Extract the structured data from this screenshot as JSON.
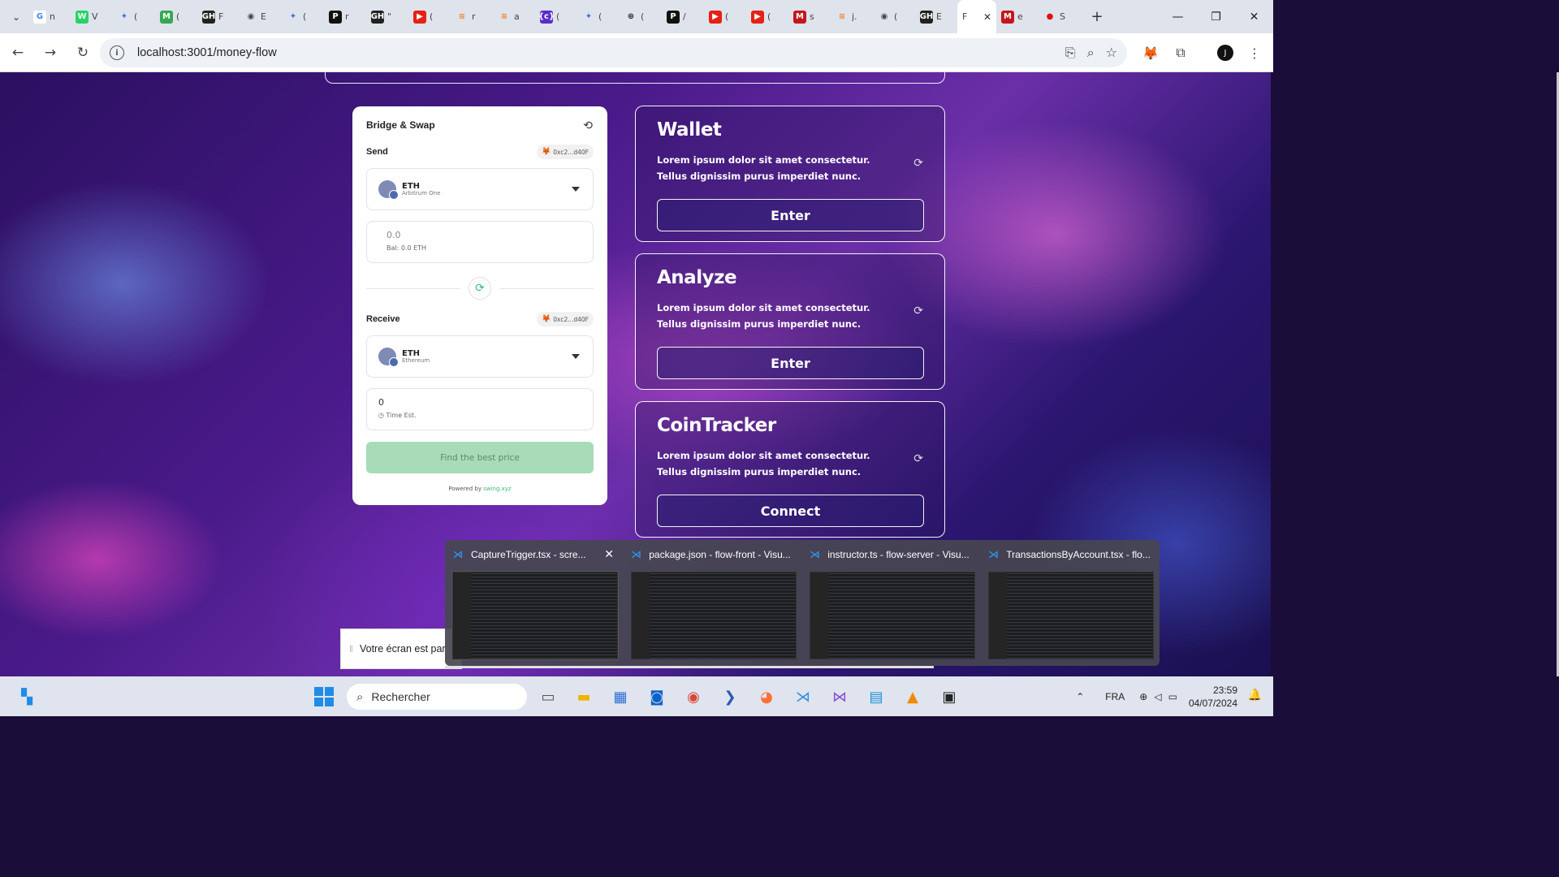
{
  "browser": {
    "tabs": [
      {
        "favicon": "G",
        "label": "n",
        "color": "#ffffff",
        "fg": "#4285f4"
      },
      {
        "favicon": "W",
        "label": "V",
        "color": "#25d366",
        "fg": "#fff"
      },
      {
        "favicon": "✦",
        "label": "(",
        "color": "transparent",
        "fg": "#3b6fe0"
      },
      {
        "favicon": "M",
        "label": "(",
        "color": "#34a853",
        "fg": "#fff"
      },
      {
        "favicon": "GH",
        "label": "F",
        "color": "#222",
        "fg": "#fff"
      },
      {
        "favicon": "◉",
        "label": "E",
        "color": "transparent",
        "fg": "#444"
      },
      {
        "favicon": "✦",
        "label": "(",
        "color": "transparent",
        "fg": "#3b6fe0"
      },
      {
        "favicon": "P",
        "label": "r",
        "color": "#111",
        "fg": "#fff"
      },
      {
        "favicon": "GH",
        "label": "\"",
        "color": "#222",
        "fg": "#fff"
      },
      {
        "favicon": "▶",
        "label": "(",
        "color": "#e62117",
        "fg": "#fff"
      },
      {
        "favicon": "≋",
        "label": "r",
        "color": "transparent",
        "fg": "#f48024"
      },
      {
        "favicon": "≋",
        "label": "a",
        "color": "transparent",
        "fg": "#f48024"
      },
      {
        "favicon": "{c}",
        "label": "(",
        "color": "#5b2bc9",
        "fg": "#fff"
      },
      {
        "favicon": "✦",
        "label": "(",
        "color": "transparent",
        "fg": "#3b6fe0"
      },
      {
        "favicon": "⊛",
        "label": "(",
        "color": "transparent",
        "fg": "#222"
      },
      {
        "favicon": "P",
        "label": "/",
        "color": "#111",
        "fg": "#fff"
      },
      {
        "favicon": "▶",
        "label": "(",
        "color": "#e62117",
        "fg": "#fff"
      },
      {
        "favicon": "▶",
        "label": "(",
        "color": "#e62117",
        "fg": "#fff"
      },
      {
        "favicon": "M",
        "label": "s",
        "color": "#c4161c",
        "fg": "#fff"
      },
      {
        "favicon": "≋",
        "label": "j.",
        "color": "transparent",
        "fg": "#f48024"
      },
      {
        "favicon": "◉",
        "label": "(",
        "color": "transparent",
        "fg": "#444"
      },
      {
        "favicon": "GH",
        "label": "E",
        "color": "#222",
        "fg": "#fff"
      }
    ],
    "active_tab": {
      "label": "F",
      "close": "✕"
    },
    "tail_tabs": [
      {
        "favicon": "M",
        "label": "e",
        "color": "#c4161c",
        "fg": "#fff"
      },
      {
        "favicon": "●",
        "label": "S",
        "color": "transparent",
        "fg": "#d11"
      }
    ],
    "url": "localhost:3001/money-flow"
  },
  "bridge": {
    "title": "Bridge & Swap",
    "send_label": "Send",
    "send_address": "0xc2...d40F",
    "send_token": {
      "name": "ETH",
      "chain": "Arbitrum One"
    },
    "send_amount_placeholder": "0.0",
    "send_balance": "Bal: 0.0 ETH",
    "receive_label": "Receive",
    "receive_address": "0xc2...d40F",
    "receive_token": {
      "name": "ETH",
      "chain": "Ethereum"
    },
    "receive_amount": "0",
    "time_est": "Time Est.",
    "find_button": "Find the best price",
    "powered_prefix": "Powered by",
    "powered_link": "swing.xyz",
    "accent": "#3cb878"
  },
  "cards": [
    {
      "title": "Wallet",
      "desc": "Lorem ipsum dolor sit amet consectetur. Tellus dignissim purus imperdiet nunc.",
      "button": "Enter"
    },
    {
      "title": "Analyze",
      "desc": "Lorem ipsum dolor sit amet consectetur. Tellus dignissim purus imperdiet nunc.",
      "button": "Enter"
    },
    {
      "title": "CoinTracker",
      "desc": "Lorem ipsum dolor sit amet consectetur. Tellus dignissim purus imperdiet nunc.",
      "button": "Connect"
    }
  ],
  "share_notice": "Votre écran est par",
  "thumbnails": [
    {
      "title": "CaptureTrigger.tsx - scre..."
    },
    {
      "title": "package.json - flow-front - Visu..."
    },
    {
      "title": "instructor.ts - flow-server - Visu..."
    },
    {
      "title": "TransactionsByAccount.tsx - flo..."
    }
  ],
  "taskbar": {
    "search_placeholder": "Rechercher",
    "language": "FRA",
    "time": "23:59",
    "date": "04/07/2024"
  }
}
